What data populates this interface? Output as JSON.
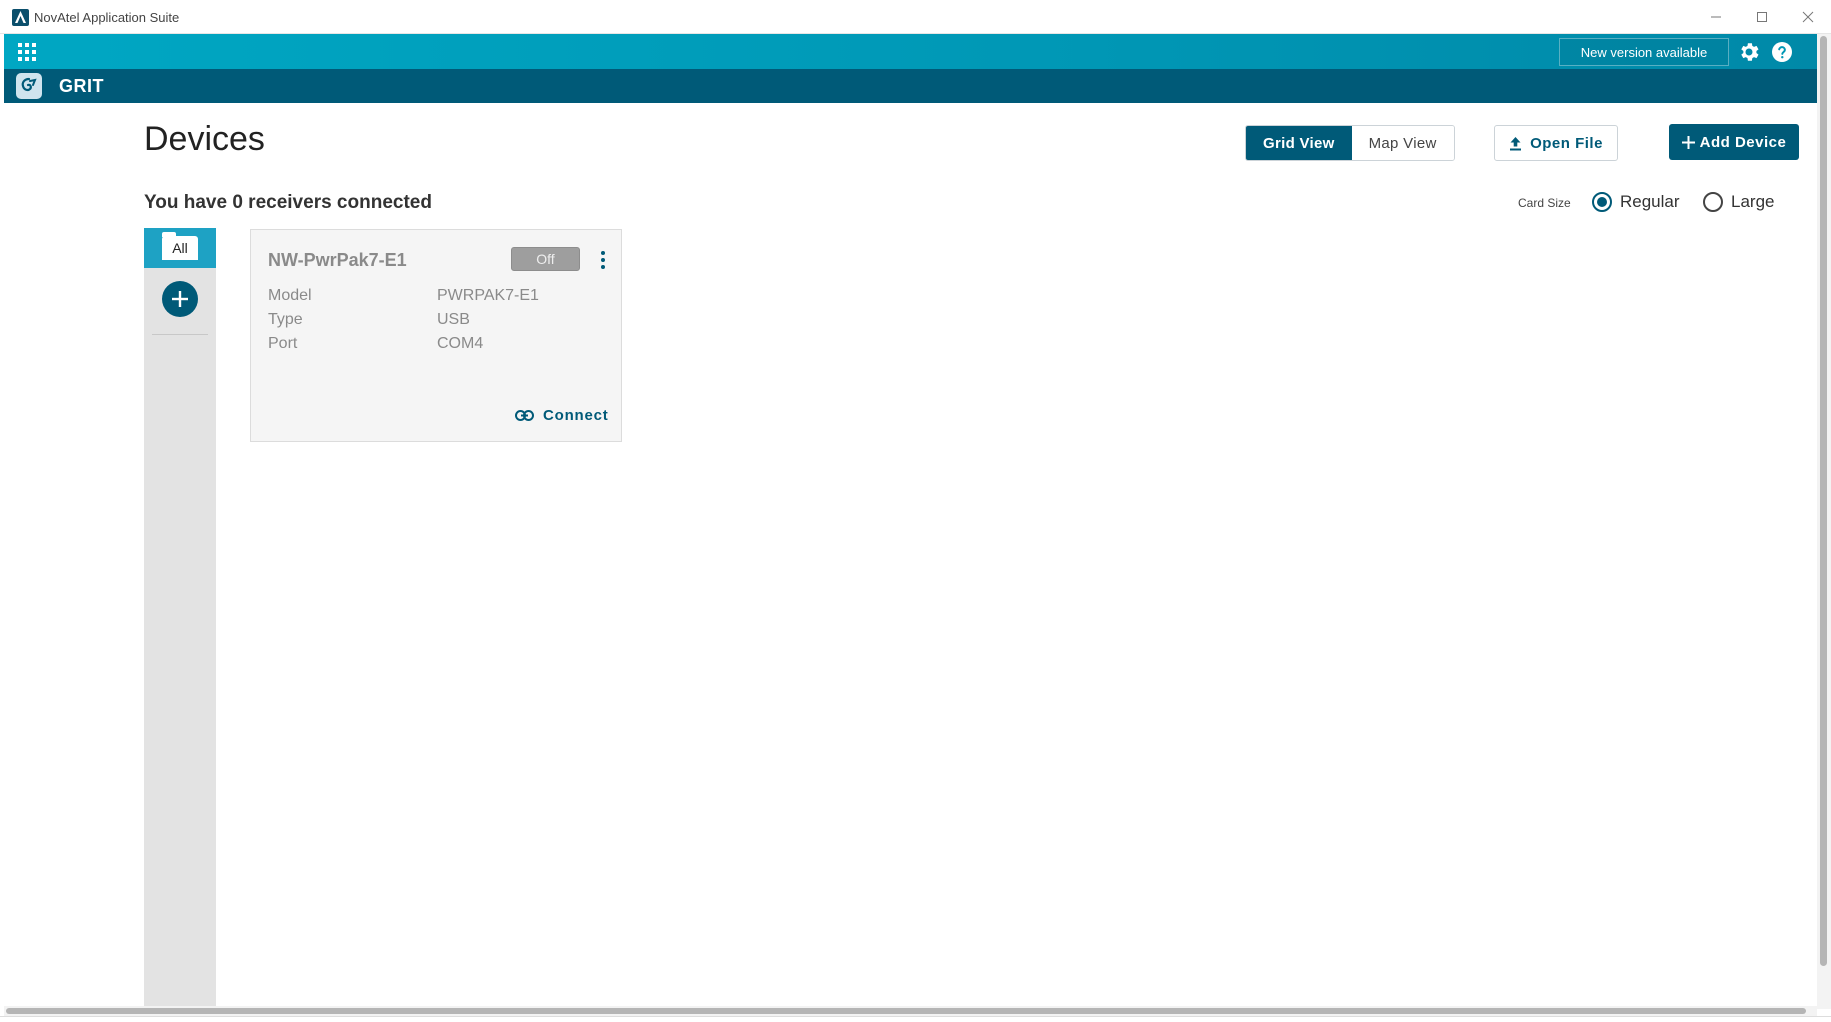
{
  "window": {
    "title": "NovAtel Application Suite"
  },
  "header": {
    "new_version_label": "New version available"
  },
  "subheader": {
    "app_name": "GRIT"
  },
  "main": {
    "page_title": "Devices",
    "receivers_text": "You have 0 receivers connected",
    "view_toggle": {
      "grid_label": "Grid View",
      "map_label": "Map View",
      "active": "Grid View"
    },
    "open_file_label": "Open File",
    "add_device_label": "Add Device",
    "card_size": {
      "label": "Card Size",
      "options": [
        "Regular",
        "Large"
      ],
      "selected": "Regular"
    }
  },
  "groups": {
    "all_label": "All"
  },
  "devices": [
    {
      "name": "NW-PwrPak7-E1",
      "status": "Off",
      "fields": [
        {
          "key": "Model",
          "value": "PWRPAK7-E1"
        },
        {
          "key": "Type",
          "value": "USB"
        },
        {
          "key": "Port",
          "value": "COM4"
        }
      ],
      "connect_label": "Connect"
    }
  ],
  "colors": {
    "accent": "#005a78",
    "header_gradient_start": "#00a7c3",
    "group_active": "#1ea2c4",
    "status_off": "#9e9e9e"
  },
  "icons": [
    "app-logo-icon",
    "minimize-icon",
    "maximize-icon",
    "close-icon",
    "apps-grid-icon",
    "gear-icon",
    "help-icon",
    "grit-logo-icon",
    "upload-icon",
    "plus-icon",
    "kebab-menu-icon",
    "link-icon"
  ]
}
